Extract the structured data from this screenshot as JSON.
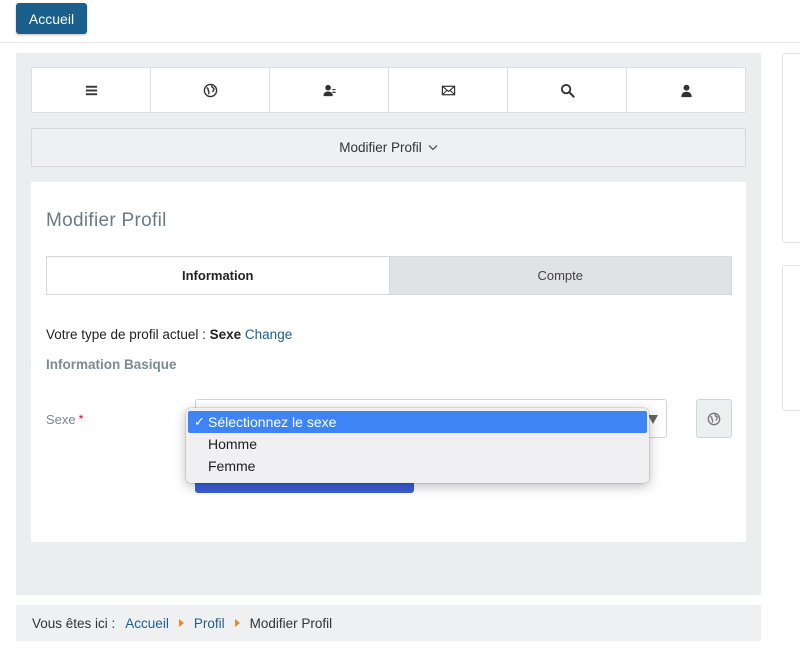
{
  "topbar": {
    "home_label": "Accueil"
  },
  "icons": [
    "menu-icon",
    "globe-icon",
    "users-icon",
    "envelope-icon",
    "search-icon",
    "user-icon"
  ],
  "profile_menu": {
    "label": "Modifier Profil"
  },
  "page": {
    "title": "Modifier Profil"
  },
  "tabs": [
    {
      "label": "Information",
      "active": true
    },
    {
      "label": "Compte",
      "active": false
    }
  ],
  "profile_type": {
    "prefix": "Votre type de profil actuel :",
    "value": "Sexe",
    "change_link": "Change"
  },
  "section_title": "Information Basique",
  "form": {
    "gender_label": "Sexe",
    "required_mark": "*"
  },
  "dropdown_options": [
    {
      "label": "Sélectionnez le sexe",
      "selected": true
    },
    {
      "label": "Homme",
      "selected": false
    },
    {
      "label": "Femme",
      "selected": false
    }
  ],
  "breadcrumb": {
    "prefix": "Vous êtes ici :",
    "items": [
      "Accueil",
      "Profil",
      "Modifier Profil"
    ]
  },
  "colors": {
    "primary": "#1b5f8c",
    "selection": "#3f84f6",
    "breadcrumb_separator": "#e8892b",
    "required": "#d0021b"
  }
}
